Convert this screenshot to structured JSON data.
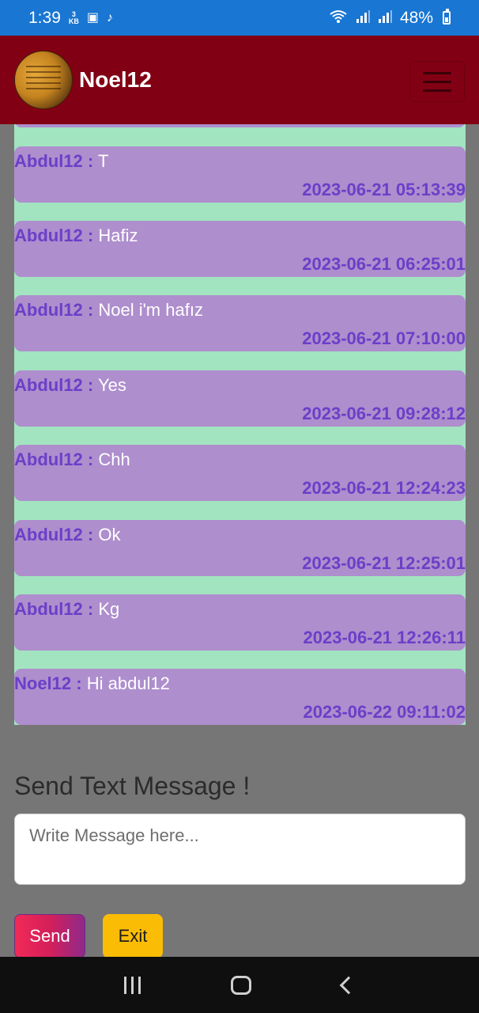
{
  "status_bar": {
    "time": "1:39",
    "data_rate_top": "3",
    "data_rate_bottom": "KB",
    "battery": "48%"
  },
  "header": {
    "title": "Noel12"
  },
  "messages": [
    {
      "user": "Abdul12 :",
      "text": "T",
      "time": "2023-06-21 05:13:39"
    },
    {
      "user": "Abdul12 :",
      "text": "Hafiz",
      "time": "2023-06-21 06:25:01"
    },
    {
      "user": "Abdul12 :",
      "text": "Noel i'm hafız",
      "time": "2023-06-21 07:10:00"
    },
    {
      "user": "Abdul12 :",
      "text": "Yes",
      "time": "2023-06-21 09:28:12"
    },
    {
      "user": "Abdul12 :",
      "text": "Chh",
      "time": "2023-06-21 12:24:23"
    },
    {
      "user": "Abdul12 :",
      "text": "Ok",
      "time": "2023-06-21 12:25:01"
    },
    {
      "user": "Abdul12 :",
      "text": "Kg",
      "time": "2023-06-21 12:26:11"
    },
    {
      "user": "Noel12 :",
      "text": "Hi abdul12",
      "time": "2023-06-22 09:11:02"
    }
  ],
  "compose": {
    "heading": "Send Text Message !",
    "placeholder": "Write Message here...",
    "send_label": "Send",
    "exit_label": "Exit"
  },
  "colors": {
    "status_bar": "#1976d2",
    "header": "#820014",
    "chat_background": "#a2e4c0",
    "message_bubble": "#ae8ecd",
    "message_accent": "#6b3fc8",
    "exit_button": "#fbbc05"
  },
  "icons": [
    "image-icon",
    "tiktok-icon",
    "wifi-icon",
    "signal-icon",
    "battery-icon",
    "avatar-image",
    "menu-icon",
    "recents-icon",
    "home-icon",
    "back-icon"
  ]
}
